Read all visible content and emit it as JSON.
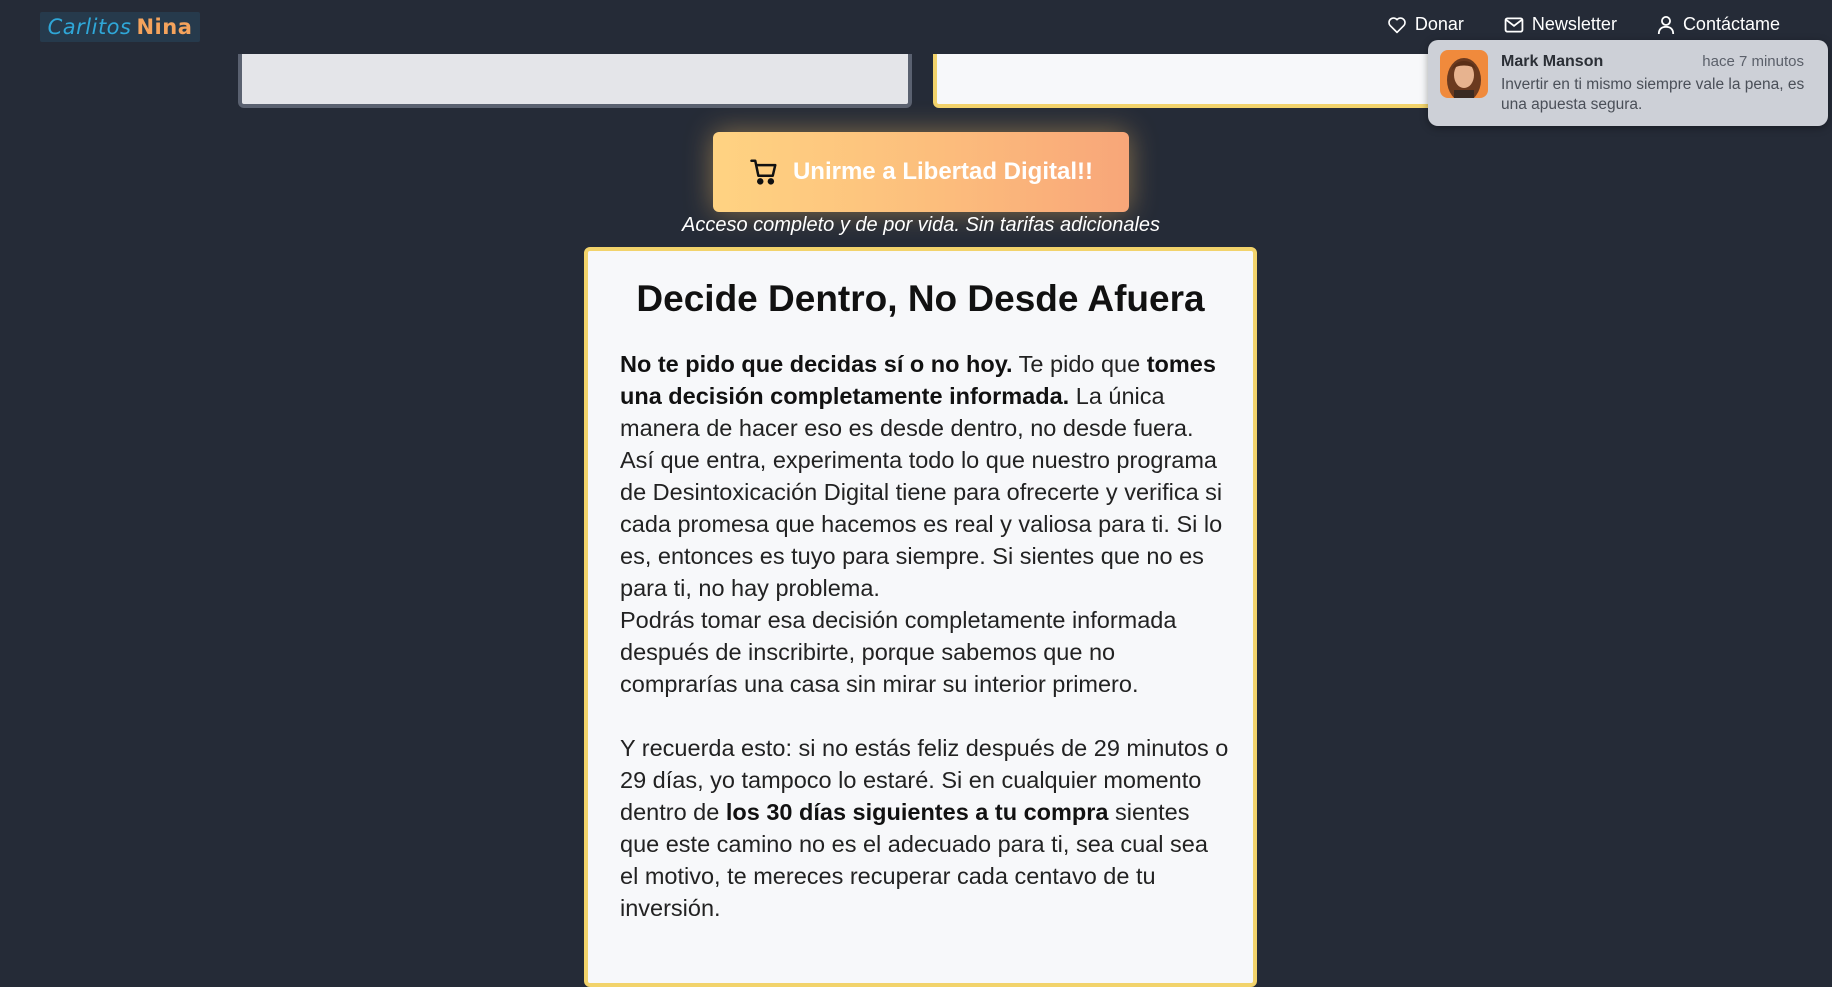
{
  "header": {
    "logo": {
      "first": "Carlitos",
      "last": "Nina"
    },
    "nav": [
      {
        "label": "Donar",
        "icon": "heart-icon"
      },
      {
        "label": "Newsletter",
        "icon": "mail-icon"
      },
      {
        "label": "Contáctame",
        "icon": "user-icon"
      }
    ]
  },
  "toast": {
    "name": "Mark Manson",
    "time": "hace 7 minutos",
    "message": "Invertir en ti mismo siempre vale la pena, es una apuesta segura."
  },
  "cta": {
    "button_label": "Unirme a Libertad Digital!!",
    "button_icon": "cart-icon",
    "subtitle": "Acceso completo y de por vida. Sin tarifas adicionales"
  },
  "main": {
    "title": "Decide Dentro, No Desde Afuera",
    "p1_bold1": "No te pido que decidas sí o no hoy.",
    "p1_text1": " Te pido que ",
    "p1_bold2": "tomes una decisión completamente informada.",
    "p1_text2": " La única manera de hacer eso es desde dentro, no desde fuera.",
    "p2": "Así que entra, experimenta todo lo que nuestro programa de Desintoxicación Digital tiene para ofrecerte y verifica si cada promesa que hacemos es real y valiosa para ti. Si lo es, entonces es tuyo para siempre. Si sientes que no es para ti, no hay problema.",
    "p3": "Podrás tomar esa decisión completamente informada después de inscribirte, porque sabemos que no comprarías una casa sin mirar su interior primero.",
    "p4_text1": "Y recuerda esto: si no estás feliz después de 29 minutos o 29 días, yo tampoco lo estaré. Si en cualquier momento dentro de ",
    "p4_bold": "los 30 días siguientes a tu compra",
    "p4_text2": " sientes que este camino no es el adecuado para ti, sea cual sea el motivo, te mereces recuperar cada centavo de tu inversión."
  },
  "colors": {
    "background": "#252b37",
    "accent_border": "#f2d36b",
    "cta_gradient_start": "#ffd382",
    "cta_gradient_end": "#f8a679"
  }
}
